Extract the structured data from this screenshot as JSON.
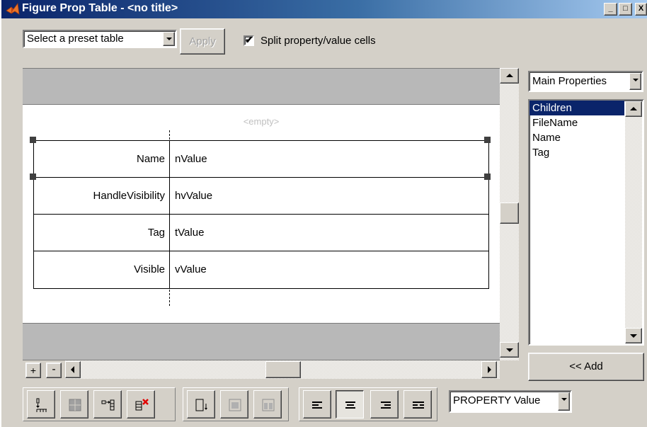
{
  "window": {
    "title": "Figure Prop Table - <no title>",
    "min_label": "_",
    "max_label": "□",
    "close_label": "X"
  },
  "top_toolbar": {
    "preset_select_value": "Select a preset table",
    "apply_label": "Apply",
    "split_checkbox_label": "Split property/value cells",
    "split_checked": true
  },
  "canvas": {
    "empty_label": "<empty>",
    "rows": [
      {
        "name": "Name",
        "value": "nValue"
      },
      {
        "name": "HandleVisibility",
        "value": "hvValue"
      },
      {
        "name": "Tag",
        "value": "tValue"
      },
      {
        "name": "Visible",
        "value": "vValue"
      }
    ],
    "add_row_label": "+",
    "remove_row_label": "-"
  },
  "right_panel": {
    "category_select_value": "Main Properties",
    "properties": [
      "Children",
      "FileName",
      "Name",
      "Tag"
    ],
    "selected_index": 0,
    "add_label": "<< Add"
  },
  "bottom_toolbar": {
    "format_select_value": "PROPERTY Value",
    "tools": [
      {
        "icon": "insert-row-icon",
        "enabled": true
      },
      {
        "icon": "merge-cells-icon",
        "enabled": false
      },
      {
        "icon": "split-cells-icon",
        "enabled": true
      },
      {
        "icon": "delete-cells-icon",
        "enabled": true
      },
      {
        "icon": "cell-height-icon",
        "enabled": true
      },
      {
        "icon": "cell-border-icon",
        "enabled": false
      },
      {
        "icon": "cell-split-grid-icon",
        "enabled": false
      },
      {
        "icon": "align-left-icon",
        "enabled": true
      },
      {
        "icon": "align-center-icon",
        "enabled": true,
        "pressed": true
      },
      {
        "icon": "align-right-icon",
        "enabled": true
      },
      {
        "icon": "align-justify-icon",
        "enabled": true
      }
    ]
  },
  "colors": {
    "titlebar_start": "#0a246a",
    "selection": "#0a246a",
    "band_gray": "#b8b8b8",
    "face": "#d4d0c8",
    "delete_red": "#e00000"
  }
}
